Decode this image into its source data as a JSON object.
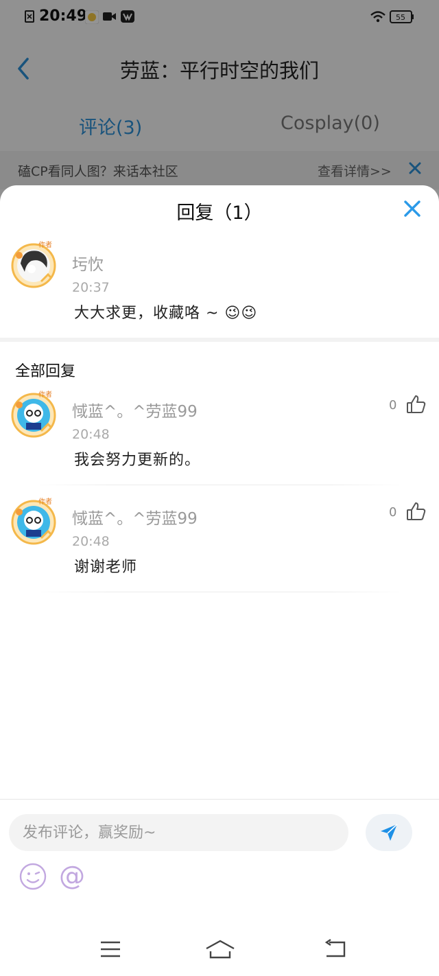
{
  "status_bar": {
    "time": "20:49",
    "battery": "55"
  },
  "header": {
    "title": "劳蓝：平行时空的我们"
  },
  "tabs": [
    {
      "label": "评论(3)"
    },
    {
      "label": "Cosplay(0)"
    }
  ],
  "banner": {
    "text": "磕CP看同人图？来话本社区",
    "link": "查看详情>>"
  },
  "sheet": {
    "title": "回复（1）",
    "original": {
      "username": "圬忺",
      "time": "20:37",
      "content": "大大求更，收藏咯 ~ 😉😉",
      "badge": "作者"
    },
    "section_title": "全部回复",
    "replies": [
      {
        "username": "惐蓝^。^劳蓝99",
        "time": "20:48",
        "content": "我会努力更新的。",
        "likes": "0",
        "badge": "作者"
      },
      {
        "username": "惐蓝^。^劳蓝99",
        "time": "20:48",
        "content": "谢谢老师",
        "likes": "0",
        "badge": "作者"
      }
    ]
  },
  "input_bar": {
    "placeholder": "发布评论，赢奖励~",
    "value": "",
    "at_symbol": "@"
  },
  "icons": {
    "back": "back-chevron-icon",
    "close": "close-icon",
    "like": "thumbs-up-icon",
    "send": "paper-plane-icon",
    "emoji": "smiley-icon",
    "nav_menu": "menu-icon",
    "nav_home": "home-icon",
    "nav_back": "return-icon"
  },
  "colors": {
    "accent": "#2b8fd6",
    "close_blue": "#2b9ae8",
    "send_blue": "#1e90e6",
    "emoji_purple": "#c2a8e0"
  }
}
